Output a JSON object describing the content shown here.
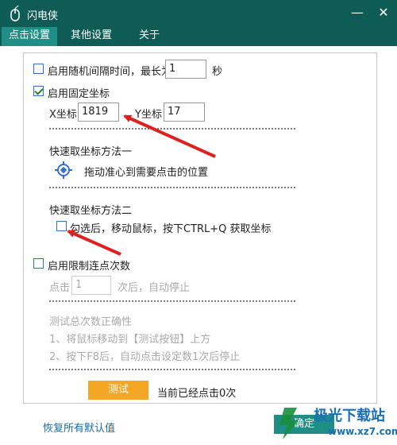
{
  "window": {
    "title": "闪电侠",
    "minimize": "—",
    "close": "✕"
  },
  "tabs": [
    {
      "label": "点击设置",
      "active": true
    },
    {
      "label": "其他设置",
      "active": false
    },
    {
      "label": "关于",
      "active": false
    }
  ],
  "random_interval": {
    "label": "启用随机间隔时间，最长为",
    "value": "1",
    "unit": "秒",
    "checked": false
  },
  "fixed_coord": {
    "label": "启用固定坐标",
    "checked": true,
    "x_label": "X坐标",
    "x_value": "1819",
    "y_label": "Y坐标",
    "y_value": "17"
  },
  "method1": {
    "title": "快速取坐标方法一",
    "desc": "拖动准心到需要点击的位置",
    "icon": "crosshair-icon"
  },
  "method2": {
    "title": "快速取坐标方法二",
    "label": "勾选后，移动鼠标，按下CTRL+Q 获取坐标",
    "checked": false
  },
  "limit_clicks": {
    "label": "启用限制连点次数",
    "checked": false,
    "prefix": "点击",
    "value": "1",
    "suffix": "次后，自动停止"
  },
  "test_section": {
    "title": "测试总次数正确性",
    "step1": "1、将鼠标移动到【测试按钮】上方",
    "step2": "2、按下F8后，自动点击设定数1次后停止",
    "button": "测试",
    "status": "当前已经点击0次"
  },
  "footer": {
    "restore": "恢复所有默认值",
    "ok": "确定"
  },
  "watermark": {
    "text": "极光下载站",
    "url": "www.xz7.com"
  },
  "colors": {
    "titlebar": "#0f5c57",
    "active_tab": "#1f8e84",
    "test_button": "#f5a623",
    "link": "#1c6aa8",
    "arrow": "#e02020"
  }
}
